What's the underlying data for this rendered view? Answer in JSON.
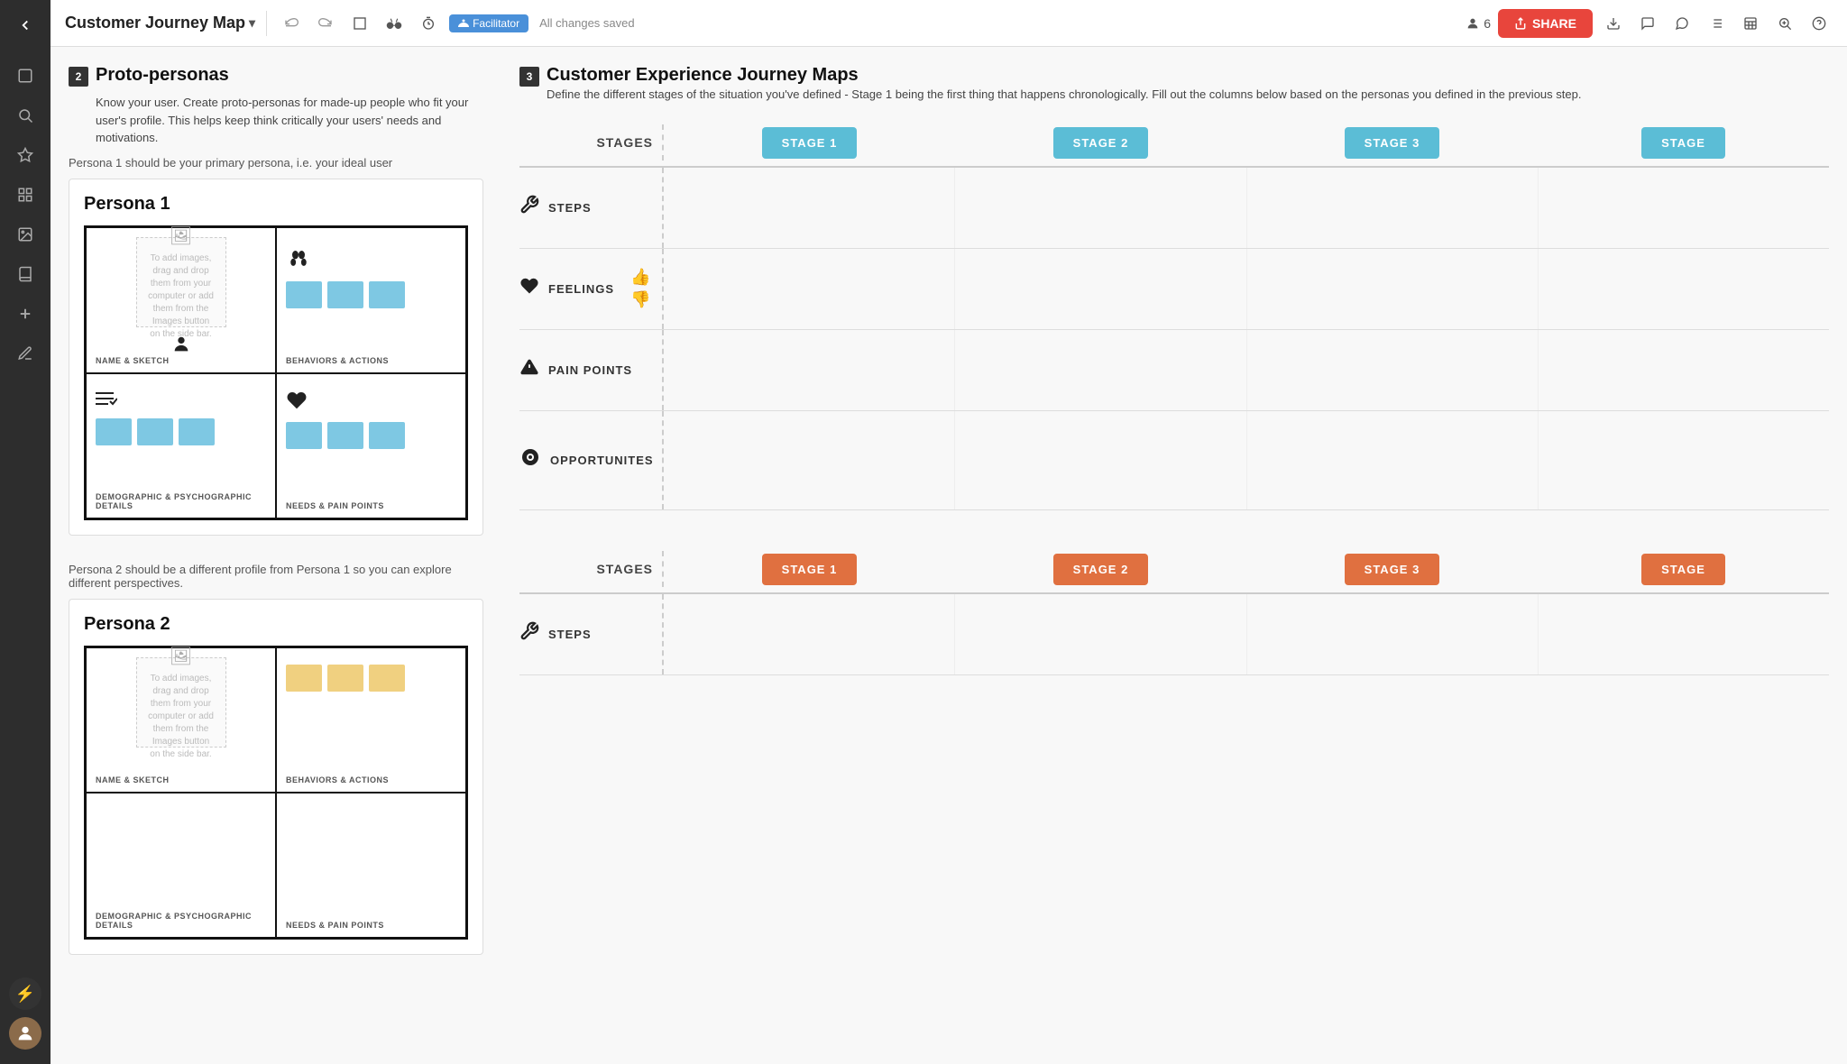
{
  "app": {
    "title": "Customer Journey Map",
    "autosave": "All changes saved"
  },
  "toolbar": {
    "undo_label": "↺",
    "redo_label": "↻",
    "frame_label": "⬜",
    "binoculars_label": "👓",
    "timer_label": "⏱",
    "facilitator_label": "Facilitator",
    "share_label": "SHARE",
    "users_count": "6",
    "download_label": "⬇",
    "chat_label": "💬",
    "comment_label": "🗨",
    "list_label": "☰",
    "table_label": "⊞",
    "search_label": "🔍",
    "help_label": "?"
  },
  "sidebar": {
    "back_icon": "←",
    "page_icon": "⬜",
    "search_icon": "🔍",
    "star_icon": "★",
    "grid_icon": "⊞",
    "image_icon": "🖼",
    "book_icon": "📚",
    "plus_icon": "+",
    "pen_icon": "✏",
    "bolt_label": "⚡",
    "avatar_label": "U"
  },
  "section2": {
    "number": "2",
    "title": "Proto-personas",
    "desc": "Know your user. Create proto-personas for made-up people who fit your user's profile. This helps keep think critically your users' needs and motivations.",
    "note": "Persona 1 should be your primary persona, i.e. your ideal user",
    "persona1_title": "Persona 1",
    "persona2_title": "Persona 2",
    "persona2_note": "Persona 2 should be a different profile from Persona 1 so you can explore different perspectives.",
    "quadrant_labels": {
      "name_sketch": "NAME & SKETCH",
      "behaviors": "BEHAVIORS & ACTIONS",
      "demographic": "DEMOGRAPHIC & PSYCHOGRAPHIC DETAILS",
      "needs": "NEEDS & PAIN POINTS"
    },
    "image_placeholder_text": "To add images, drag and drop them from your computer or add them from the Images button on the side bar."
  },
  "section3": {
    "number": "3",
    "title": "Customer Experience Journey Maps",
    "desc": "Define the different stages of the situation you've defined - Stage 1 being the first thing that happens chronologically.  Fill out the columns below based on the personas you defined in the previous step.",
    "stages_label": "STAGES",
    "stage1_label": "STAGE 1",
    "stage2_label": "STAGE 2",
    "stage3_label": "STAGE 3",
    "stage4_label": "STAGE",
    "rows": [
      {
        "icon": "🔧",
        "label": "STEPS"
      },
      {
        "icon": "❤",
        "label": "FEELINGS"
      },
      {
        "icon": "⚠",
        "label": "PAIN POINTS"
      },
      {
        "icon": "👁",
        "label": "OPPORTUNITES"
      }
    ],
    "stage_color": "blue"
  },
  "section3_persona2": {
    "stages_label": "STAGES",
    "stage1_label": "STAGE 1",
    "stage2_label": "STAGE 2",
    "stage3_label": "STAGE 3",
    "stage4_label": "STAGE",
    "rows": [
      {
        "icon": "🔧",
        "label": "STEPS"
      }
    ],
    "stage_color": "orange"
  }
}
